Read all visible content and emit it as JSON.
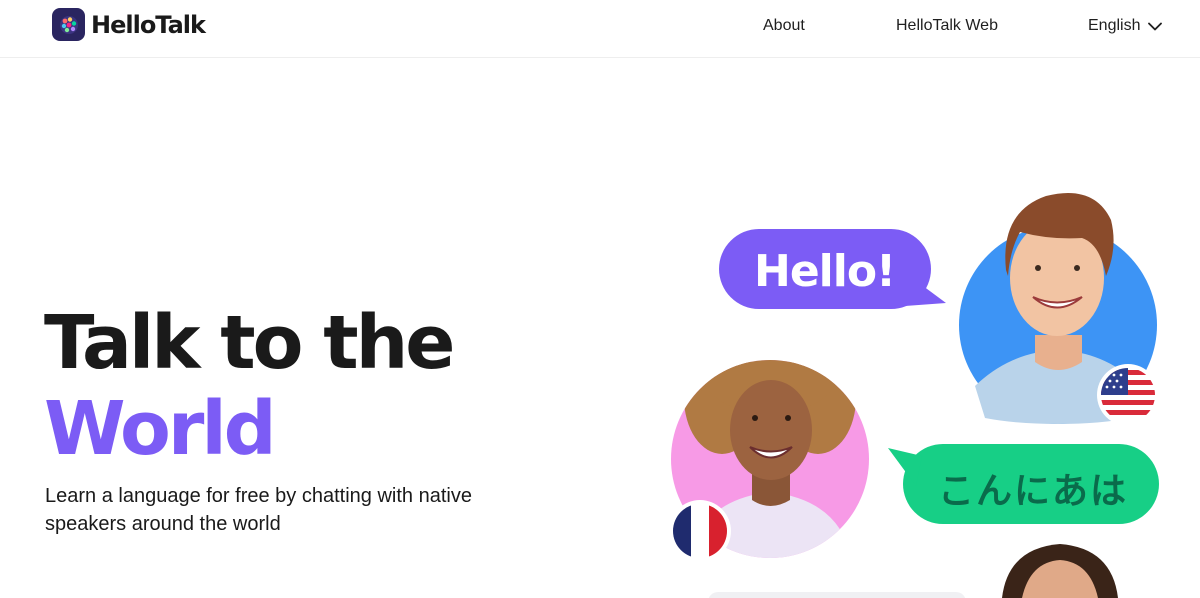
{
  "header": {
    "brand": "HelloTalk",
    "nav": {
      "about": "About",
      "web": "HelloTalk Web",
      "language": "English"
    }
  },
  "hero": {
    "title_line1": "Talk to the",
    "title_line2": "World",
    "subtitle": "Learn a language for free by chatting with native speakers around the world"
  },
  "illustration": {
    "bubble_english": "Hello!",
    "bubble_japanese": "こんにあは",
    "flags": [
      "us-flag-icon",
      "france-flag-icon"
    ]
  },
  "colors": {
    "accent": "#7c5cf5",
    "bubble_purple": "#7c5cf5",
    "bubble_green": "#17cf86",
    "circle_blue": "#3d94f5",
    "circle_pink": "#f79ae6",
    "text": "#1a1a1a"
  }
}
